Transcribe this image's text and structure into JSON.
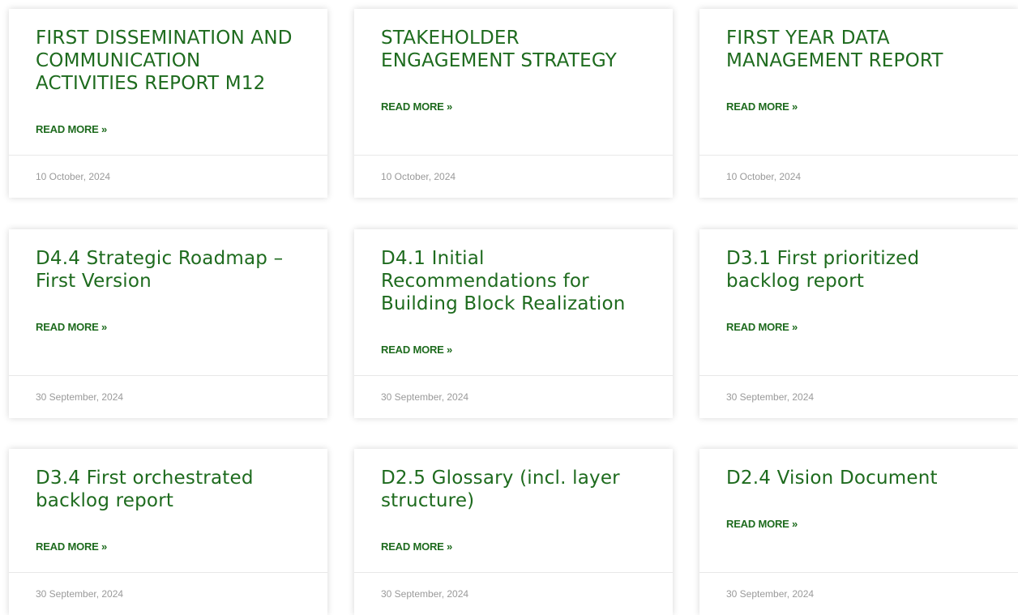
{
  "colors": {
    "accent": "#1e6b1e",
    "date": "#9a9a9a",
    "divider": "#e8e8e8"
  },
  "posts": [
    {
      "title": "FIRST DISSEMINATION AND COMMUNICATION ACTIVITIES REPORT M12",
      "read_more": "READ MORE »",
      "date": "10 October, 2024"
    },
    {
      "title": "STAKEHOLDER ENGAGEMENT STRATEGY",
      "read_more": "READ MORE »",
      "date": "10 October, 2024"
    },
    {
      "title": "FIRST YEAR DATA MANAGEMENT REPORT",
      "read_more": "READ MORE »",
      "date": "10 October, 2024"
    },
    {
      "title": "D4.4 Strategic Roadmap – First Version",
      "read_more": "READ MORE »",
      "date": "30 September, 2024"
    },
    {
      "title": "D4.1 Initial Recommendations for Building Block Realization",
      "read_more": "READ MORE »",
      "date": "30 September, 2024"
    },
    {
      "title": "D3.1 First prioritized backlog report",
      "read_more": "READ MORE »",
      "date": "30 September, 2024"
    },
    {
      "title": "D3.4 First orchestrated backlog report",
      "read_more": "READ MORE »",
      "date": "30 September, 2024"
    },
    {
      "title": "D2.5 Glossary (incl. layer structure)",
      "read_more": "READ MORE »",
      "date": "30 September, 2024"
    },
    {
      "title": "D2.4 Vision Document",
      "read_more": "READ MORE »",
      "date": "30 September, 2024"
    }
  ]
}
